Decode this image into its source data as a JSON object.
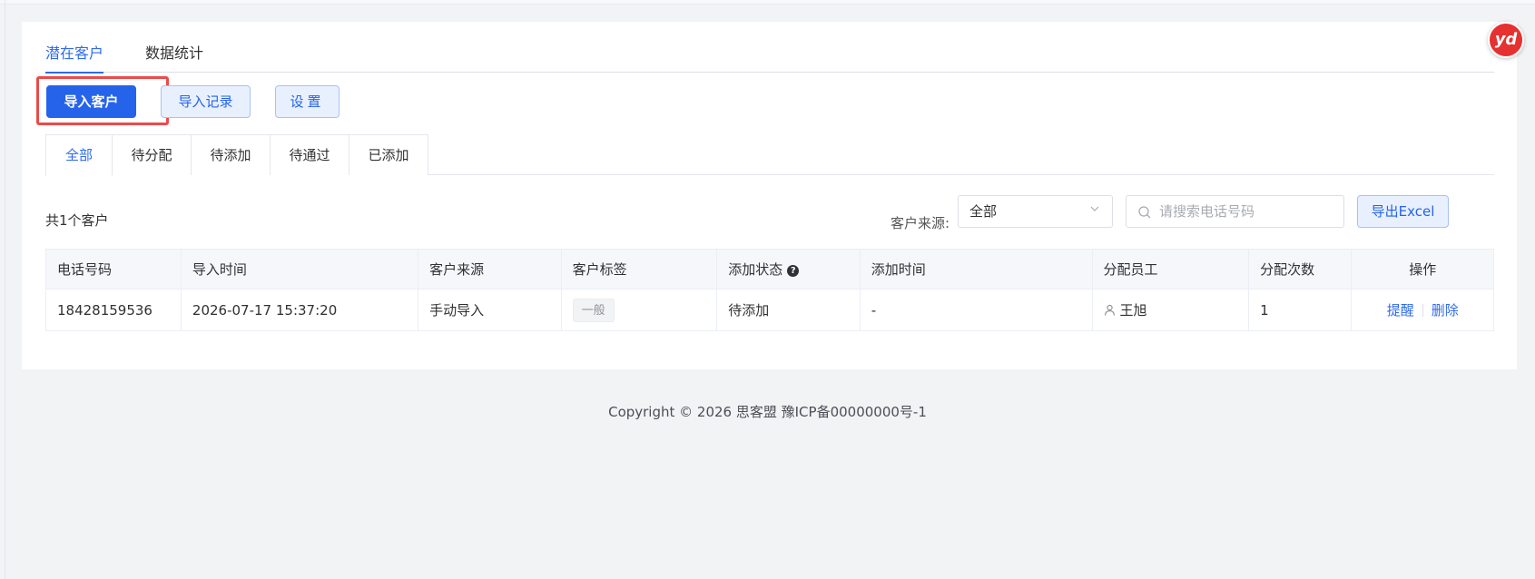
{
  "top_tabs": [
    {
      "label": "潜在客户",
      "active": true
    },
    {
      "label": "数据统计",
      "active": false
    }
  ],
  "buttons": {
    "import_customers": "导入客户",
    "import_records": "导入记录",
    "settings": "设置"
  },
  "status_tabs": [
    {
      "label": "全部",
      "active": true
    },
    {
      "label": "待分配",
      "active": false
    },
    {
      "label": "待添加",
      "active": false
    },
    {
      "label": "待通过",
      "active": false
    },
    {
      "label": "已添加",
      "active": false
    }
  ],
  "filters": {
    "count_text": "共1个客户",
    "source_label": "客户来源:",
    "source_value": "全部",
    "search_placeholder": "请搜索电话号码",
    "export_label": "导出Excel"
  },
  "table": {
    "headers": [
      "电话号码",
      "导入时间",
      "客户来源",
      "客户标签",
      "添加状态",
      "添加时间",
      "分配员工",
      "分配次数",
      "操作"
    ],
    "rows": [
      {
        "phone": "18428159536",
        "import_time": "2026-07-17 15:37:20",
        "source": "手动导入",
        "tag": "一般",
        "status": "待添加",
        "add_time": "-",
        "staff": "王旭",
        "assign_count": "1",
        "actions": [
          "提醒",
          "删除"
        ]
      }
    ]
  },
  "footer": {
    "copyright": "Copyright © 2026 思客盟 豫ICP备00000000号-1"
  },
  "logo": {
    "text": "yd"
  },
  "colors": {
    "primary": "#2563eb",
    "highlight": "#ec4a4a",
    "logo": "#e5312f"
  }
}
